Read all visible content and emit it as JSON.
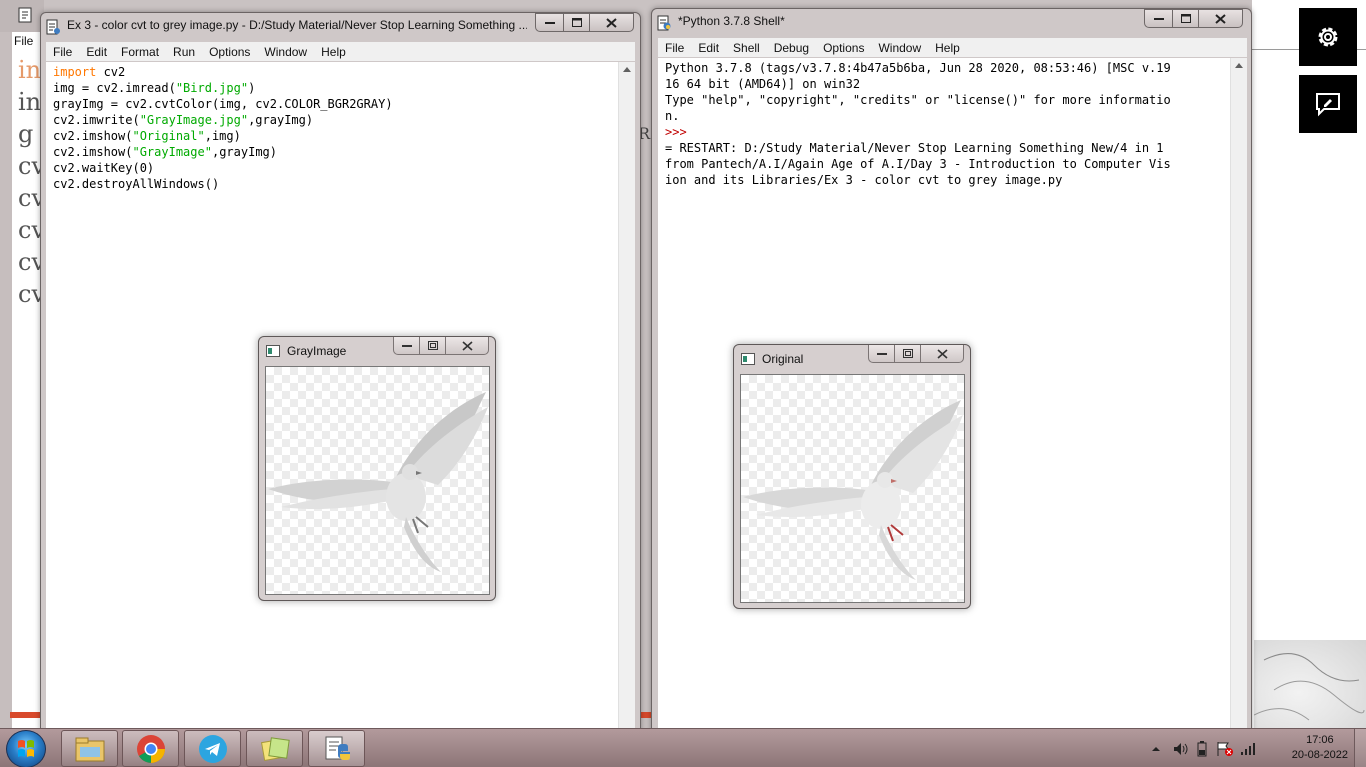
{
  "background_window": {
    "menu_label": "File",
    "code_fragments": [
      "in",
      "in",
      "g",
      "cv",
      "cv",
      "cv",
      "cv",
      "cv"
    ],
    "r_letter": "R"
  },
  "editor": {
    "title": "Ex 3 - color cvt to grey image.py - D:/Study Material/Never Stop Learning Something ...",
    "menu": [
      "File",
      "Edit",
      "Format",
      "Run",
      "Options",
      "Window",
      "Help"
    ],
    "code_lines": [
      [
        {
          "t": "import",
          "c": "kw"
        },
        {
          "t": " cv2",
          "c": ""
        }
      ],
      [
        {
          "t": "img = cv2.imread(",
          "c": ""
        },
        {
          "t": "\"Bird.jpg\"",
          "c": "str"
        },
        {
          "t": ")",
          "c": ""
        }
      ],
      [
        {
          "t": "grayImg = cv2.cvtColor(img, cv2.COLOR_BGR2GRAY)",
          "c": ""
        }
      ],
      [
        {
          "t": "cv2.imwrite(",
          "c": ""
        },
        {
          "t": "\"GrayImage.jpg\"",
          "c": "str"
        },
        {
          "t": ",grayImg)",
          "c": ""
        }
      ],
      [
        {
          "t": "cv2.imshow(",
          "c": ""
        },
        {
          "t": "\"Original\"",
          "c": "str"
        },
        {
          "t": ",img)",
          "c": ""
        }
      ],
      [
        {
          "t": "cv2.imshow(",
          "c": ""
        },
        {
          "t": "\"GrayImage\"",
          "c": "str"
        },
        {
          "t": ",grayImg)",
          "c": ""
        }
      ],
      [
        {
          "t": "cv2.waitKey(0)",
          "c": ""
        }
      ],
      [
        {
          "t": "cv2.destroyAllWindows()",
          "c": ""
        }
      ]
    ]
  },
  "shell": {
    "title": "*Python 3.7.8 Shell*",
    "menu": [
      "File",
      "Edit",
      "Shell",
      "Debug",
      "Options",
      "Window",
      "Help"
    ],
    "lines": [
      {
        "t": "Python 3.7.8 (tags/v3.7.8:4b47a5b6ba, Jun 28 2020, 08:53:46) [MSC v.19",
        "c": ""
      },
      {
        "t": "16 64 bit (AMD64)] on win32",
        "c": ""
      },
      {
        "t": "Type \"help\", \"copyright\", \"credits\" or \"license()\" for more informatio",
        "c": ""
      },
      {
        "t": "n.",
        "c": ""
      },
      {
        "t": ">>> ",
        "c": "prompt"
      },
      {
        "t": "= RESTART: D:/Study Material/Never Stop Learning Something New/4 in 1",
        "c": ""
      },
      {
        "t": "from Pantech/A.I/Again Age of A.I/Day 3 - Introduction to Computer Vis",
        "c": ""
      },
      {
        "t": "ion and its Libraries/Ex 3 - color cvt to grey image.py",
        "c": ""
      }
    ]
  },
  "gray_window": {
    "title": "GrayImage"
  },
  "original_window": {
    "title": "Original"
  },
  "side_buttons": {
    "settings_icon": "gear-icon",
    "feedback_icon": "feedback-icon"
  },
  "taskbar": {
    "apps": [
      "file-explorer-icon",
      "chrome-icon",
      "telegram-icon",
      "sticky-notes-icon",
      "python-idle-icon"
    ],
    "time": "17:06",
    "date": "20-08-2022"
  },
  "colors": {
    "keyword": "#ff7700",
    "string": "#00aa00",
    "prompt": "#c00000",
    "taskbar": "#9e8688"
  }
}
